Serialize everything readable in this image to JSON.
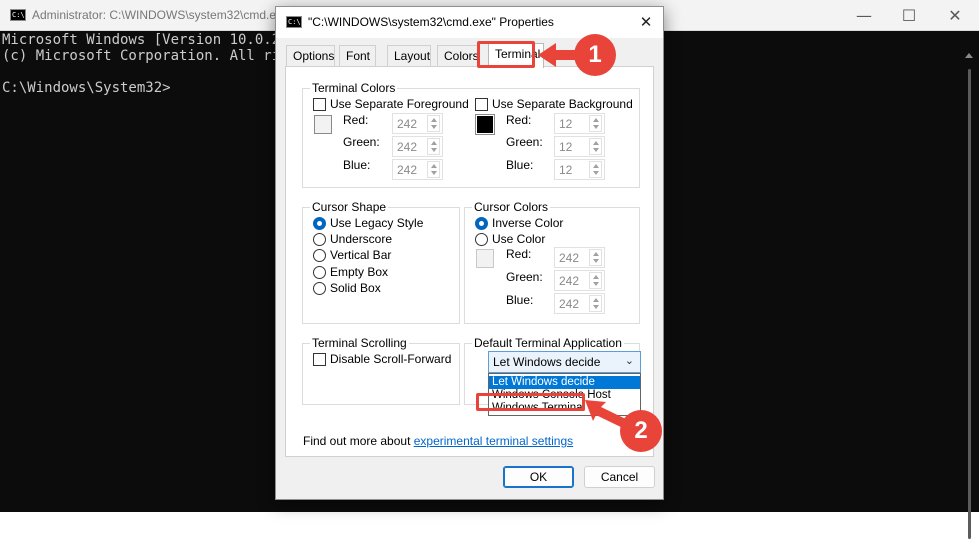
{
  "console": {
    "title": "Administrator: C:\\WINDOWS\\system32\\cmd.ex",
    "icon_text": "C:\\",
    "lines": [
      "Microsoft Windows [Version 10.0.226",
      "(c) Microsoft Corporation. All righ",
      "",
      "C:\\Windows\\System32>"
    ],
    "controls": {
      "minimize": "—",
      "maximize": "☐",
      "close": "✕"
    }
  },
  "dialog": {
    "title": "\"C:\\WINDOWS\\system32\\cmd.exe\" Properties",
    "close": "✕",
    "tabs": [
      "Options",
      "Font",
      "Layout",
      "Colors",
      "Terminal"
    ],
    "active_tab": "Terminal",
    "terminal_colors": {
      "legend": "Terminal Colors",
      "foreground": {
        "label": "Use Separate Foreground",
        "checked": false,
        "swatch_color": "#f2f2f2",
        "red": {
          "label": "Red:",
          "value": "242"
        },
        "green": {
          "label": "Green:",
          "value": "242"
        },
        "blue": {
          "label": "Blue:",
          "value": "242"
        }
      },
      "background": {
        "label": "Use Separate Background",
        "checked": false,
        "swatch_color": "#0c0c0c",
        "red": {
          "label": "Red:",
          "value": "12"
        },
        "green": {
          "label": "Green:",
          "value": "12"
        },
        "blue": {
          "label": "Blue:",
          "value": "12"
        }
      }
    },
    "cursor_shape": {
      "legend": "Cursor Shape",
      "options": [
        "Use Legacy Style",
        "Underscore",
        "Vertical Bar",
        "Empty Box",
        "Solid Box"
      ],
      "selected": "Use Legacy Style"
    },
    "cursor_colors": {
      "legend": "Cursor Colors",
      "options": [
        "Inverse Color",
        "Use Color"
      ],
      "selected": "Inverse Color",
      "red": {
        "label": "Red:",
        "value": "242"
      },
      "green": {
        "label": "Green:",
        "value": "242"
      },
      "blue": {
        "label": "Blue:",
        "value": "242"
      }
    },
    "terminal_scrolling": {
      "legend": "Terminal Scrolling",
      "checkbox": "Disable Scroll-Forward",
      "checked": false
    },
    "default_terminal": {
      "legend": "Default Terminal Application",
      "selected": "Let Windows decide",
      "options": [
        "Let Windows decide",
        "Windows Console Host",
        "Windows Terminal"
      ],
      "highlighted_option": "Let Windows decide"
    },
    "footer": {
      "text": "Find out more about ",
      "link": "experimental terminal settings"
    },
    "buttons": {
      "ok": "OK",
      "cancel": "Cancel"
    }
  },
  "callouts": [
    {
      "number": "1",
      "target": "Terminal tab"
    },
    {
      "number": "2",
      "target": "Windows Terminal option"
    }
  ],
  "colors": {
    "accent": "#0067c0",
    "callout": "#e8443a",
    "console_bg": "#0c0c0c",
    "console_text": "#cccccc"
  }
}
